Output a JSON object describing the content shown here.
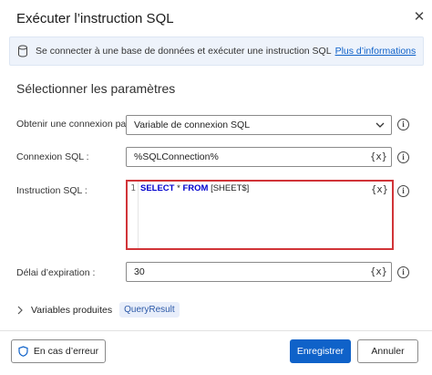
{
  "dialog": {
    "title": "Exécuter l’instruction SQL",
    "close_glyph": "✕"
  },
  "banner": {
    "text": "Se connecter à une base de données et exécuter une instruction SQL",
    "link": "Plus d’informations"
  },
  "section_title": "Sélectionner les paramètres",
  "params": {
    "connection_mode_label": "Obtenir une connexion par :",
    "connection_mode_value": "Variable de connexion SQL",
    "sql_connection_label": "Connexion SQL :",
    "sql_connection_value": "%SQLConnection%",
    "sql_statement_label": "Instruction SQL :",
    "sql_line_number": "1",
    "sql_kw_select": "SELECT",
    "sql_star": " * ",
    "sql_kw_from": "FROM",
    "sql_table": " [SHEET$]",
    "timeout_label": "Délai d’expiration :",
    "timeout_value": "30",
    "var_button": "{x}",
    "info_glyph": "i"
  },
  "produced_vars": {
    "label": "Variables produites",
    "badge": "QueryResult"
  },
  "footer": {
    "on_error": "En cas d’erreur",
    "save": "Enregistrer",
    "cancel": "Annuler"
  }
}
